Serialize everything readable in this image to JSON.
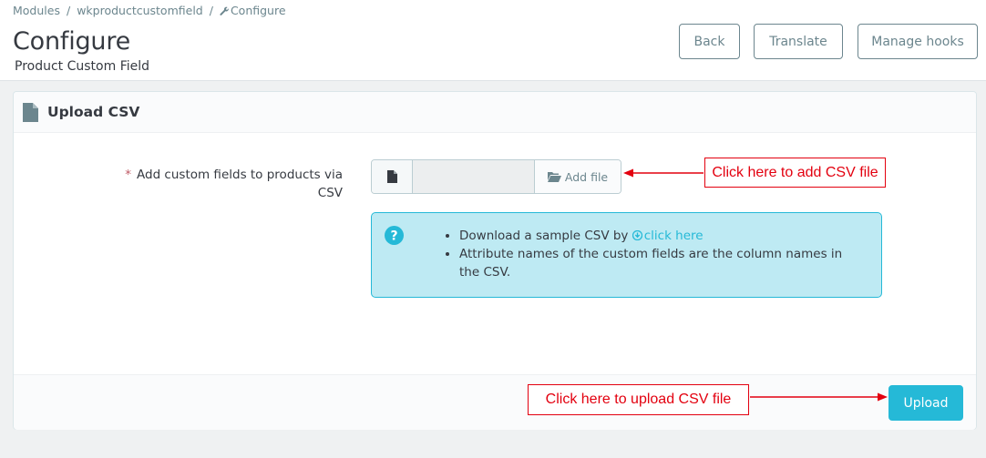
{
  "breadcrumb": {
    "items": [
      "Modules",
      "wkproductcustomfield",
      "Configure"
    ],
    "separator": "/"
  },
  "header": {
    "title": "Configure",
    "subtitle": "Product Custom Field"
  },
  "toolbar": {
    "back_label": "Back",
    "translate_label": "Translate",
    "manage_hooks_label": "Manage hooks"
  },
  "panel": {
    "title": "Upload CSV",
    "title_icon": "file-icon",
    "field": {
      "required_marker": "*",
      "label": "Add custom fields to products via CSV",
      "file_name_value": "",
      "add_file_label": "Add file"
    },
    "info": {
      "icon": "question-circle-icon",
      "bullet1_prefix": "Download a sample CSV by",
      "bullet1_link": "click here",
      "bullet2": "Attribute names of the custom fields are the column names in the CSV."
    },
    "footer": {
      "upload_label": "Upload"
    }
  },
  "annotations": {
    "add_file_callout": "Click here to add CSV file",
    "upload_callout": "Click here to upload CSV file"
  },
  "colors": {
    "accent": "#25b9d7",
    "info_background": "#beeaf3",
    "annotation_red": "#e3000f",
    "text": "#363a41",
    "muted": "#6c868e"
  }
}
